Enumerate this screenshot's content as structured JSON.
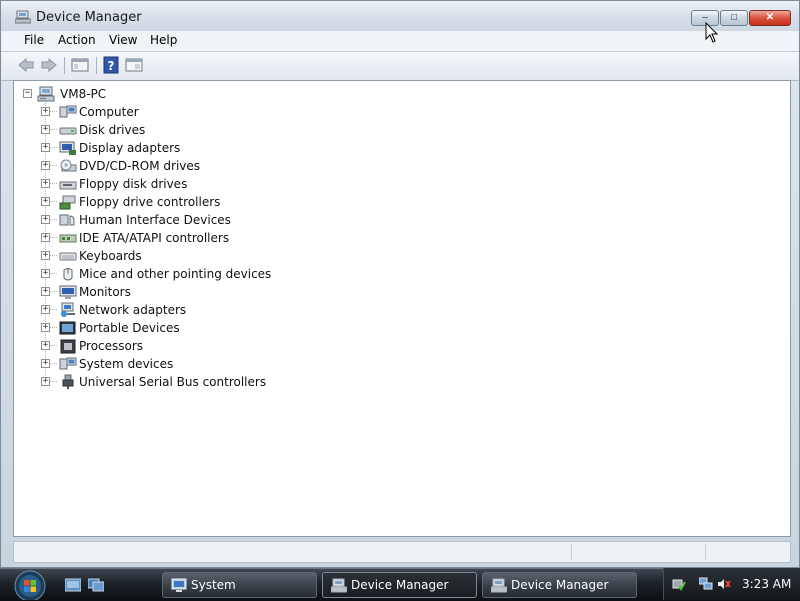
{
  "window": {
    "title": "Device Manager",
    "minimize_label": "–",
    "maximize_label": "□",
    "close_label": "✕"
  },
  "menu": {
    "items": [
      {
        "label": "File"
      },
      {
        "label": "Action"
      },
      {
        "label": "View"
      },
      {
        "label": "Help"
      }
    ]
  },
  "toolbar": {
    "buttons": [
      "back-arrow-icon",
      "forward-arrow-icon",
      "properties-icon",
      "help-icon",
      "show-hide-tree-icon"
    ]
  },
  "tree": {
    "root": {
      "label": "VM8-PC",
      "expanded_symbol": "−"
    },
    "collapsed_symbol": "+",
    "items": [
      {
        "label": "Computer",
        "icon": "computer-icon"
      },
      {
        "label": "Disk drives",
        "icon": "disk-drive-icon"
      },
      {
        "label": "Display adapters",
        "icon": "display-adapter-icon"
      },
      {
        "label": "DVD/CD-ROM drives",
        "icon": "dvd-drive-icon"
      },
      {
        "label": "Floppy disk drives",
        "icon": "floppy-drive-icon"
      },
      {
        "label": "Floppy drive controllers",
        "icon": "floppy-controller-icon"
      },
      {
        "label": "Human Interface Devices",
        "icon": "hid-icon"
      },
      {
        "label": "IDE ATA/ATAPI controllers",
        "icon": "ide-controller-icon"
      },
      {
        "label": "Keyboards",
        "icon": "keyboard-icon"
      },
      {
        "label": "Mice and other pointing devices",
        "icon": "mouse-icon"
      },
      {
        "label": "Monitors",
        "icon": "monitor-icon"
      },
      {
        "label": "Network adapters",
        "icon": "network-adapter-icon"
      },
      {
        "label": "Portable Devices",
        "icon": "portable-device-icon"
      },
      {
        "label": "Processors",
        "icon": "processor-icon"
      },
      {
        "label": "System devices",
        "icon": "system-devices-icon"
      },
      {
        "label": "Universal Serial Bus controllers",
        "icon": "usb-icon"
      }
    ]
  },
  "taskbar": {
    "tasks": [
      {
        "label": "System",
        "active": false
      },
      {
        "label": "Device Manager",
        "active": true
      },
      {
        "label": "Device Manager",
        "active": false
      }
    ],
    "clock": "3:23 AM"
  }
}
